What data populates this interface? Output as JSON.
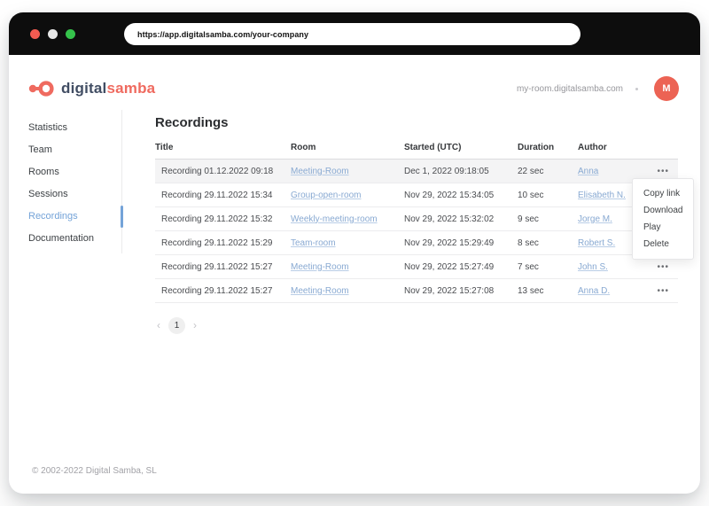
{
  "browser": {
    "url": "https://app.digitalsamba.com/your-company",
    "traffic_lights": [
      "close",
      "minimize",
      "maximize"
    ]
  },
  "header": {
    "logo_digital": "digital",
    "logo_samba": "samba",
    "room_domain": "my-room.digitalsamba.com",
    "avatar_initial": "M"
  },
  "sidebar": {
    "items": [
      {
        "label": "Statistics",
        "active": false
      },
      {
        "label": "Team",
        "active": false
      },
      {
        "label": "Rooms",
        "active": false
      },
      {
        "label": "Sessions",
        "active": false
      },
      {
        "label": "Recordings",
        "active": true
      },
      {
        "label": "Documentation",
        "active": false
      }
    ]
  },
  "main": {
    "title": "Recordings",
    "table": {
      "columns": [
        "Title",
        "Room",
        "Started (UTC)",
        "Duration",
        "Author"
      ],
      "actions_icon": "•••",
      "rows": [
        {
          "title": "Recording 01.12.2022 09:18",
          "room": "Meeting-Room",
          "started": "Dec 1, 2022 09:18:05",
          "duration": "22 sec",
          "author": "Anna",
          "highlighted": true,
          "show_dots": true
        },
        {
          "title": "Recording 29.11.2022 15:34",
          "room": "Group-open-room",
          "started": "Nov 29, 2022 15:34:05",
          "duration": "10 sec",
          "author": "Elisabeth N.",
          "highlighted": false,
          "show_dots": false
        },
        {
          "title": "Recording 29.11.2022 15:32",
          "room": "Weekly-meeting-room",
          "started": "Nov 29, 2022 15:32:02",
          "duration": "9 sec",
          "author": "Jorge M.",
          "highlighted": false,
          "show_dots": false
        },
        {
          "title": "Recording 29.11.2022 15:29",
          "room": "Team-room",
          "started": "Nov 29, 2022 15:29:49",
          "duration": "8 sec",
          "author": "Robert S.",
          "highlighted": false,
          "show_dots": false
        },
        {
          "title": "Recording 29.11.2022 15:27",
          "room": "Meeting-Room",
          "started": "Nov 29, 2022 15:27:49",
          "duration": "7 sec",
          "author": "John S.",
          "highlighted": false,
          "show_dots": true
        },
        {
          "title": "Recording 29.11.2022 15:27",
          "room": "Meeting-Room",
          "started": "Nov 29, 2022 15:27:08",
          "duration": "13 sec",
          "author": "Anna D.",
          "highlighted": false,
          "show_dots": true
        }
      ]
    },
    "context_menu": {
      "items": [
        "Copy link",
        "Download",
        "Play",
        "Delete"
      ]
    },
    "pagination": {
      "prev": "‹",
      "current_page": "1",
      "next": "›"
    }
  },
  "footer": {
    "copyright": "© 2002-2022 Digital Samba, SL"
  },
  "colors": {
    "brand_coral": "#EF6A5F",
    "brand_navy": "#414D63",
    "link_blue": "#88A9D2",
    "sidebar_active_blue": "#74A3D8",
    "chrome_black": "#0D0D0D",
    "traffic_red": "#F15B51",
    "traffic_white": "#E7E7E7",
    "traffic_green": "#35C24B"
  }
}
